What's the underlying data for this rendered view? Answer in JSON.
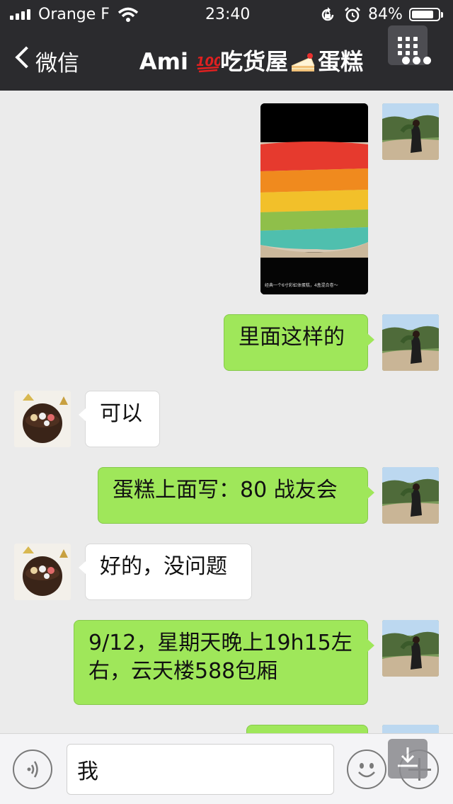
{
  "status_bar": {
    "carrier": "Orange F",
    "time": "23:40",
    "battery_percent": "84%",
    "battery_level": 0.84,
    "icons": [
      "signal-icon",
      "wifi-icon",
      "rotation-lock-icon",
      "alarm-icon",
      "battery-icon"
    ]
  },
  "nav": {
    "back_label": "微信",
    "title_part1": "Ami ",
    "title_part2": "吃货屋",
    "title_part3": "蛋糕",
    "icons": [
      "chevron-left-icon",
      "hundred-points-emoji",
      "cake-slice-emoji",
      "grid-menu-icon",
      "more-icon"
    ]
  },
  "messages": [
    {
      "side": "out",
      "type": "image",
      "caption": "经典一个6寸彩虹体蛋糕，4盒混合卷～"
    },
    {
      "side": "out",
      "type": "text",
      "text": "里面这样的"
    },
    {
      "side": "in",
      "type": "text",
      "text": "可以"
    },
    {
      "side": "out",
      "type": "text",
      "text": "蛋糕上面写：80 战友会"
    },
    {
      "side": "in",
      "type": "text",
      "text": "好的，没问题"
    },
    {
      "side": "out",
      "type": "text",
      "lines": [
        "9/12，星期天晚上19h15左",
        "右，云天楼588包厢"
      ]
    }
  ],
  "input_bar": {
    "value": "我",
    "icons": [
      "voice-icon",
      "emoji-icon",
      "plus-icon",
      "download-icon"
    ]
  },
  "colors": {
    "topbar": "#2b2b2e",
    "chat_background": "#ebebeb",
    "outgoing_bubble": "#9fe75a",
    "incoming_bubble": "#ffffff"
  }
}
